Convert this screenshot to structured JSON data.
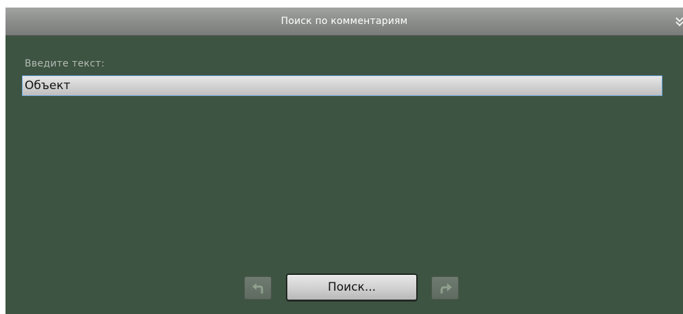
{
  "window": {
    "title": "Поиск по комментариям"
  },
  "icons": {
    "collapse": "chevron-double-down-icon",
    "previous": "arrow-back-icon",
    "next": "arrow-forward-icon"
  },
  "form": {
    "prompt_label": "Введите текст:",
    "search_value": "Объект"
  },
  "buttons": {
    "search_label": "Поиск..."
  },
  "colors": {
    "background": "#3e5442",
    "titlebar": "#8e908e",
    "input_focus_border": "#6aa8e0",
    "nav_icon": "#8fa08f"
  }
}
